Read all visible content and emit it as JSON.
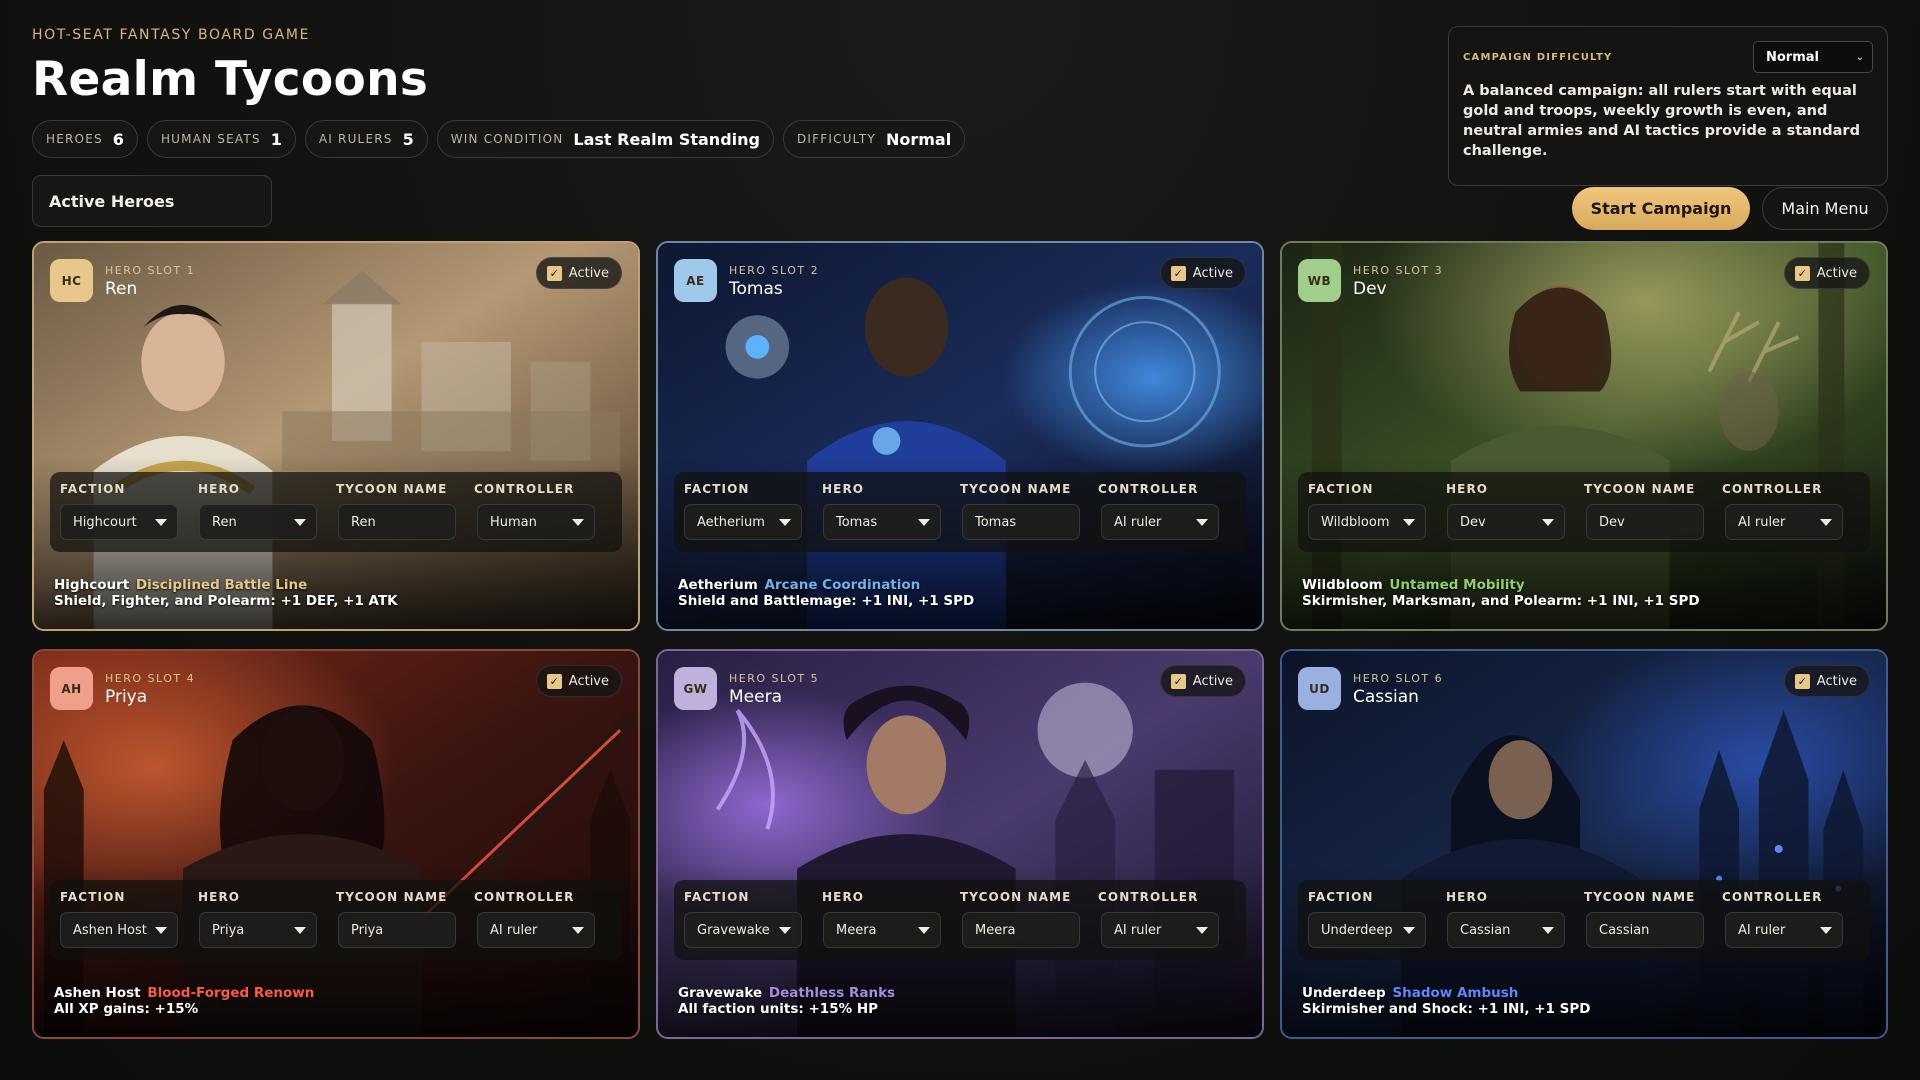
{
  "header": {
    "eyebrow": "HOT-SEAT FANTASY BOARD GAME",
    "title": "Realm Tycoons",
    "stats": [
      {
        "label": "Heroes",
        "value": "6"
      },
      {
        "label": "Human seats",
        "value": "1"
      },
      {
        "label": "AI rulers",
        "value": "5"
      },
      {
        "label": "Win condition",
        "value": "Last Realm Standing"
      },
      {
        "label": "Difficulty",
        "value": "Normal"
      }
    ],
    "active_tab": "Active Heroes"
  },
  "difficulty_panel": {
    "label": "CAMPAIGN DIFFICULTY",
    "selected": "Normal",
    "description": "A balanced campaign: all rulers start with equal gold and troops, weekly growth is even, and neutral armies and AI tactics provide a standard challenge."
  },
  "actions": {
    "start": "Start Campaign",
    "menu": "Main Menu"
  },
  "field_labels": {
    "faction": "FACTION",
    "hero": "HERO",
    "tycoon": "TYCOON NAME",
    "controller": "CONTROLLER"
  },
  "active_label": "Active",
  "colors": {
    "accent_gold": "#e3b96e",
    "highcourt": "#e8c88a",
    "aetherium": "#6fb2ee",
    "wildbloom": "#8fd06a",
    "ashen_host": "#ff5a3c",
    "gravewake": "#a88ce0",
    "underdeep": "#5c88ff"
  },
  "cards": [
    {
      "badge": "HC",
      "slot": "HERO SLOT 1",
      "name": "Ren",
      "active": true,
      "faction": "Highcourt",
      "hero": "Ren",
      "tycoon": "Ren",
      "controller": "Human",
      "trait_faction": "Highcourt",
      "trait_name": "Disciplined Battle Line",
      "trait_desc": "Shield, Fighter, and Polearm: +1 DEF, +1 ATK"
    },
    {
      "badge": "AE",
      "slot": "HERO SLOT 2",
      "name": "Tomas",
      "active": true,
      "faction": "Aetherium",
      "hero": "Tomas",
      "tycoon": "Tomas",
      "controller": "AI ruler",
      "trait_faction": "Aetherium",
      "trait_name": "Arcane Coordination",
      "trait_desc": "Shield and Battlemage: +1 INI, +1 SPD"
    },
    {
      "badge": "WB",
      "slot": "HERO SLOT 3",
      "name": "Dev",
      "active": true,
      "faction": "Wildbloom",
      "hero": "Dev",
      "tycoon": "Dev",
      "controller": "AI ruler",
      "trait_faction": "Wildbloom",
      "trait_name": "Untamed Mobility",
      "trait_desc": "Skirmisher, Marksman, and Polearm: +1 INI, +1 SPD"
    },
    {
      "badge": "AH",
      "slot": "HERO SLOT 4",
      "name": "Priya",
      "active": true,
      "faction": "Ashen Host",
      "hero": "Priya",
      "tycoon": "Priya",
      "controller": "AI ruler",
      "trait_faction": "Ashen Host",
      "trait_name": "Blood-Forged Renown",
      "trait_desc": "All XP gains: +15%"
    },
    {
      "badge": "GW",
      "slot": "HERO SLOT 5",
      "name": "Meera",
      "active": true,
      "faction": "Gravewake",
      "hero": "Meera",
      "tycoon": "Meera",
      "controller": "AI ruler",
      "trait_faction": "Gravewake",
      "trait_name": "Deathless Ranks",
      "trait_desc": "All faction units: +15% HP"
    },
    {
      "badge": "UD",
      "slot": "HERO SLOT 6",
      "name": "Cassian",
      "active": true,
      "faction": "Underdeep",
      "hero": "Cassian",
      "tycoon": "Cassian",
      "controller": "AI ruler",
      "trait_faction": "Underdeep",
      "trait_name": "Shadow Ambush",
      "trait_desc": "Skirmisher and Shock: +1 INI, +1 SPD"
    }
  ]
}
